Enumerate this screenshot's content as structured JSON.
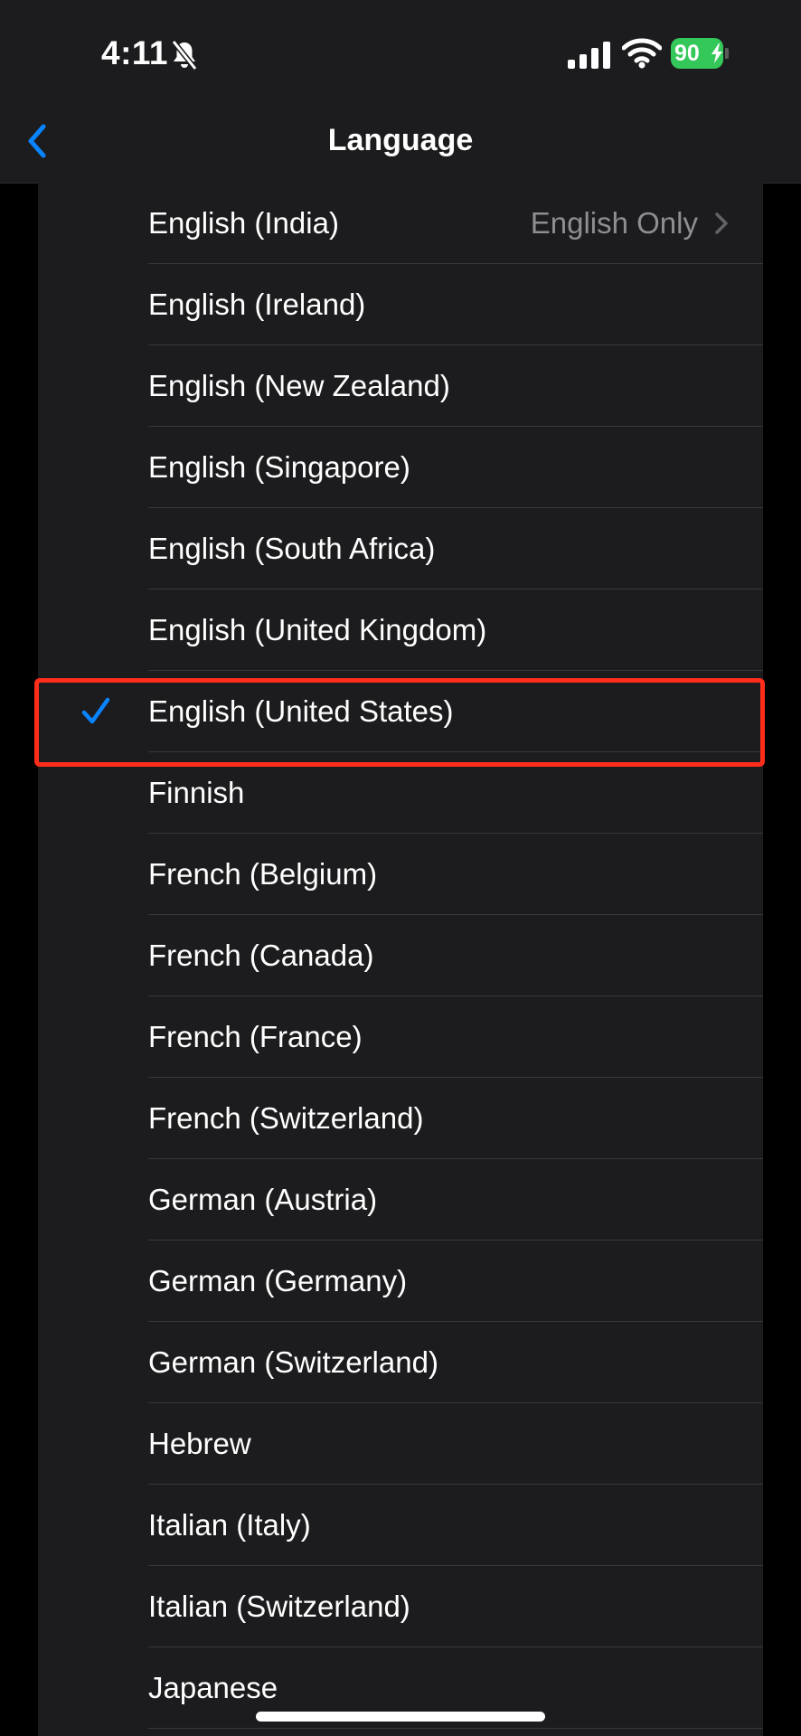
{
  "status_bar": {
    "time": "4:11",
    "battery_level": "90",
    "icons": [
      "bell-slash-icon",
      "signal-icon",
      "wifi-icon",
      "battery-charging-icon"
    ]
  },
  "nav": {
    "title": "Language",
    "back_icon": "chevron-left-icon"
  },
  "colors": {
    "accent": "#0a84ff",
    "battery": "#34c759",
    "highlight": "#ff2d1a"
  },
  "languages": [
    {
      "label": "English (India)",
      "detail": "English Only",
      "selected": false
    },
    {
      "label": "English (Ireland)",
      "selected": false
    },
    {
      "label": "English (New Zealand)",
      "selected": false
    },
    {
      "label": "English (Singapore)",
      "selected": false
    },
    {
      "label": "English (South Africa)",
      "selected": false
    },
    {
      "label": "English (United Kingdom)",
      "selected": false
    },
    {
      "label": "English (United States)",
      "selected": true
    },
    {
      "label": "Finnish",
      "selected": false
    },
    {
      "label": "French (Belgium)",
      "selected": false
    },
    {
      "label": "French (Canada)",
      "selected": false
    },
    {
      "label": "French (France)",
      "selected": false
    },
    {
      "label": "French (Switzerland)",
      "selected": false
    },
    {
      "label": "German (Austria)",
      "selected": false
    },
    {
      "label": "German (Germany)",
      "selected": false
    },
    {
      "label": "German (Switzerland)",
      "selected": false
    },
    {
      "label": "Hebrew",
      "selected": false
    },
    {
      "label": "Italian (Italy)",
      "selected": false
    },
    {
      "label": "Italian (Switzerland)",
      "selected": false
    },
    {
      "label": "Japanese",
      "selected": false
    }
  ]
}
